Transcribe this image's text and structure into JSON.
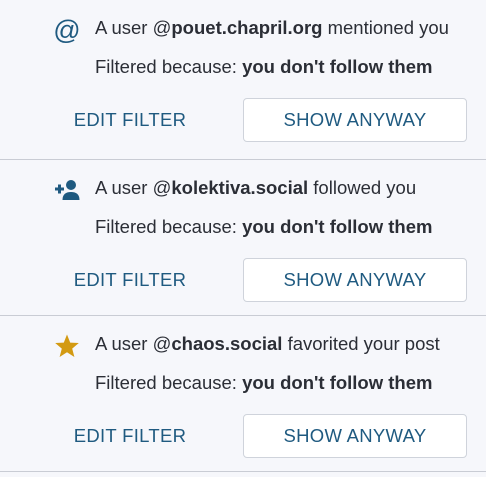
{
  "colors": {
    "accent": "#1f5a80",
    "star": "#d39a12",
    "text": "#2b2e36",
    "background": "#f6f7fb",
    "divider": "#c9ccd4"
  },
  "notifications": [
    {
      "icon": "at-sign-icon",
      "prefix": "A user @",
      "account": "pouet.chapril.org",
      "suffix": " mentioned you",
      "filter_label": "Filtered because: ",
      "filter_reason": "you don't follow them",
      "edit_label": "EDIT FILTER",
      "show_label": "SHOW ANYWAY"
    },
    {
      "icon": "person-add-icon",
      "prefix": "A user @",
      "account": "kolektiva.social",
      "suffix": " followed you",
      "filter_label": "Filtered because: ",
      "filter_reason": "you don't follow them",
      "edit_label": "EDIT FILTER",
      "show_label": "SHOW ANYWAY"
    },
    {
      "icon": "star-icon",
      "prefix": "A user @",
      "account": "chaos.social",
      "suffix": " favorited your post",
      "filter_label": "Filtered because: ",
      "filter_reason": "you don't follow them",
      "edit_label": "EDIT FILTER",
      "show_label": "SHOW ANYWAY"
    }
  ]
}
